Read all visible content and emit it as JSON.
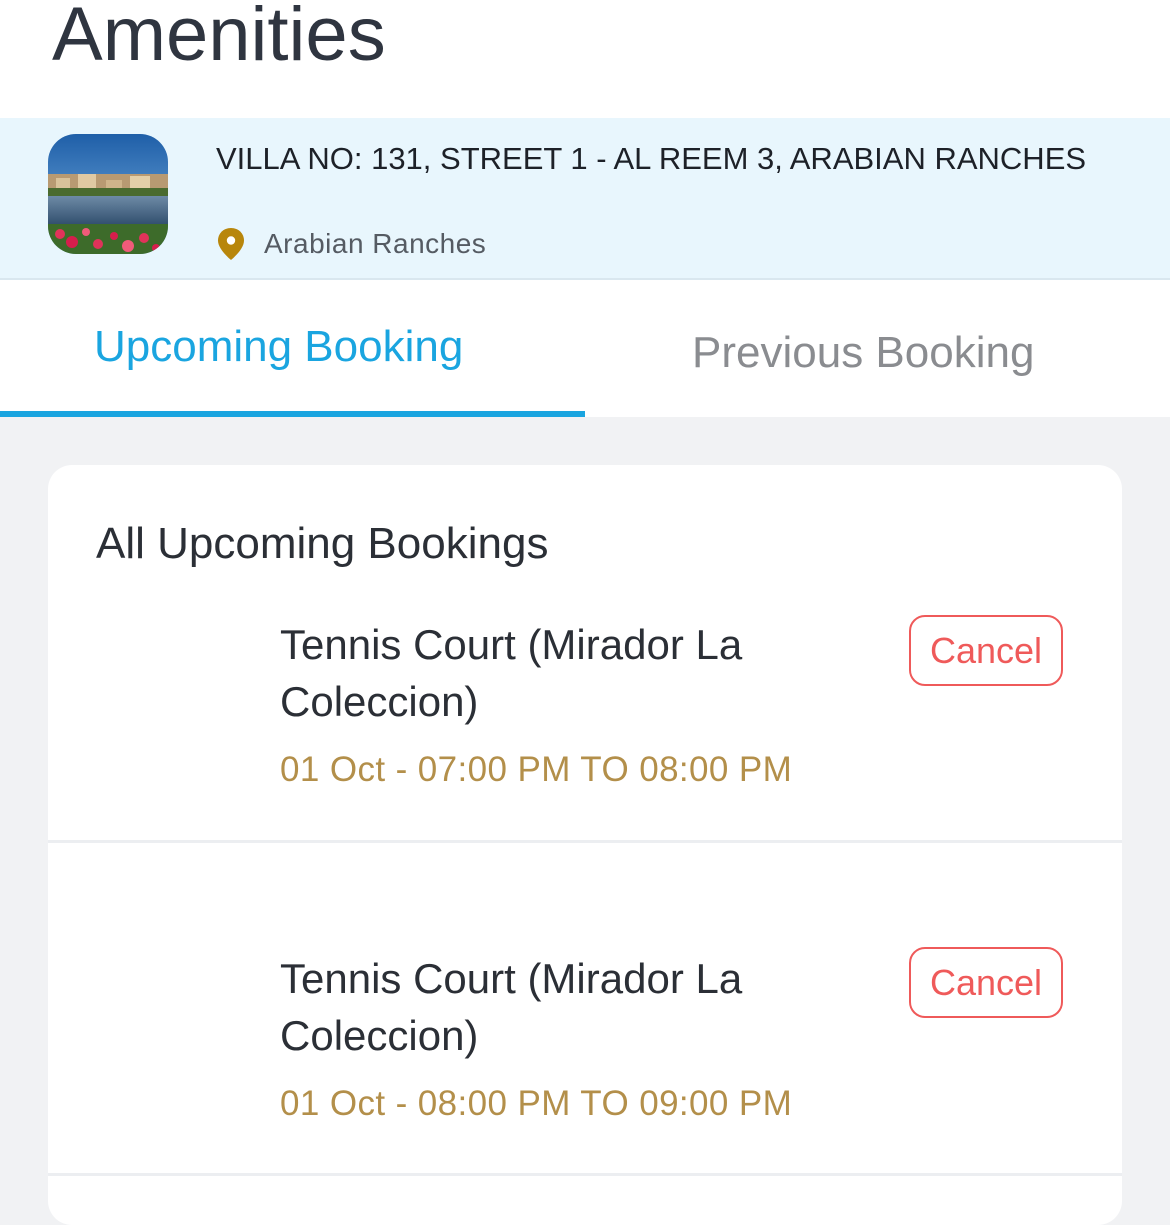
{
  "header": {
    "title": "Amenities"
  },
  "property": {
    "address": "VILLA NO: 131, STREET 1 - AL REEM 3, ARABIAN RANCHES",
    "community": "Arabian Ranches",
    "pin_color": "#b8860b"
  },
  "tabs": [
    {
      "label": "Upcoming Booking",
      "active": true
    },
    {
      "label": "Previous Booking",
      "active": false
    }
  ],
  "section": {
    "title": "All Upcoming Bookings"
  },
  "bookings": [
    {
      "amenity": "Tennis Court (Mirador La Coleccion)",
      "time": "01 Oct - 07:00 PM TO 08:00 PM",
      "cancel_label": "Cancel"
    },
    {
      "amenity": "Tennis Court (Mirador La Coleccion)",
      "time": "01 Oct - 08:00 PM TO 09:00 PM",
      "cancel_label": "Cancel"
    }
  ],
  "colors": {
    "accent": "#1aa5e0",
    "cancel": "#ef5a5a",
    "time": "#b38f4a",
    "property_bg": "#e8f6fd"
  }
}
